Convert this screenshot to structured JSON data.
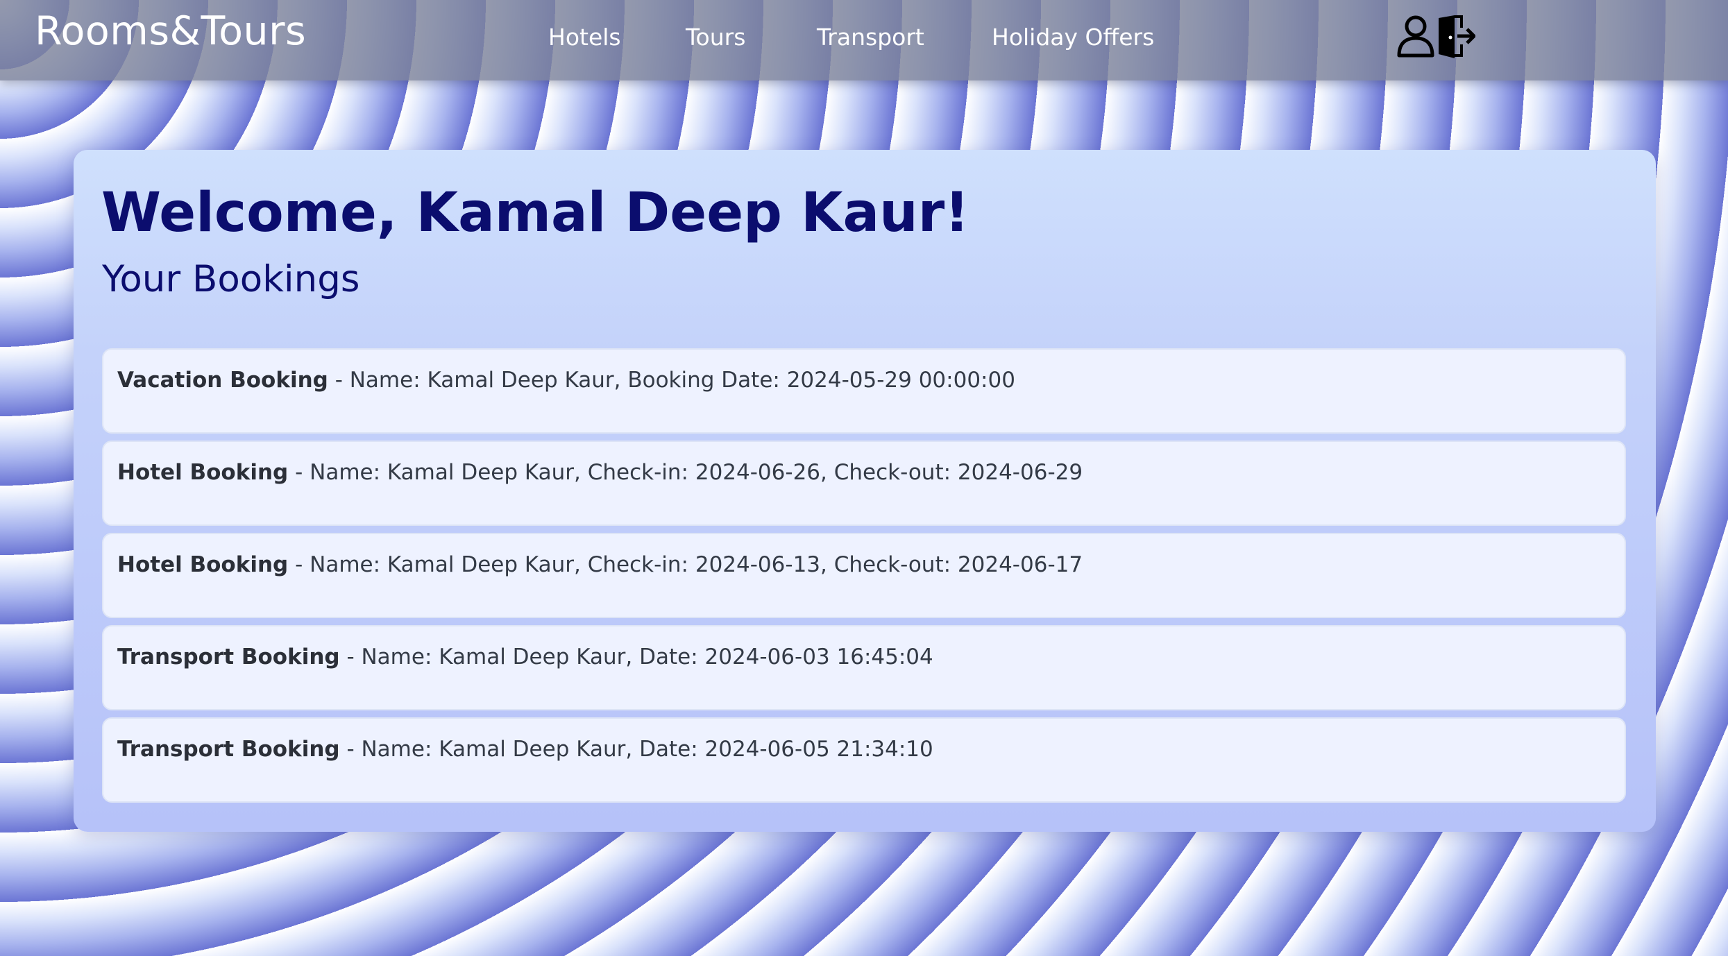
{
  "nav": {
    "brand": "Rooms&Tours",
    "links": [
      "Hotels",
      "Tours",
      "Transport",
      "Holiday Offers"
    ],
    "icons": [
      "user-icon",
      "logout-icon"
    ]
  },
  "main": {
    "welcome": "Welcome, Kamal Deep Kaur!",
    "subtitle": "Your Bookings",
    "bookings": [
      {
        "type": "Vacation Booking",
        "details": " - Name: Kamal Deep Kaur, Booking Date: 2024-05-29 00:00:00"
      },
      {
        "type": "Hotel Booking",
        "details": " - Name: Kamal Deep Kaur, Check-in: 2024-06-26, Check-out: 2024-06-29"
      },
      {
        "type": "Hotel Booking",
        "details": " - Name: Kamal Deep Kaur, Check-in: 2024-06-13, Check-out: 2024-06-17"
      },
      {
        "type": "Transport Booking",
        "details": " - Name: Kamal Deep Kaur, Date: 2024-06-03 16:45:04"
      },
      {
        "type": "Transport Booking",
        "details": " - Name: Kamal Deep Kaur, Date: 2024-06-05 21:34:10"
      }
    ]
  },
  "colors": {
    "heading": "#0b0d6e",
    "navbar": "#7d829b",
    "card": "#eef2ff"
  }
}
